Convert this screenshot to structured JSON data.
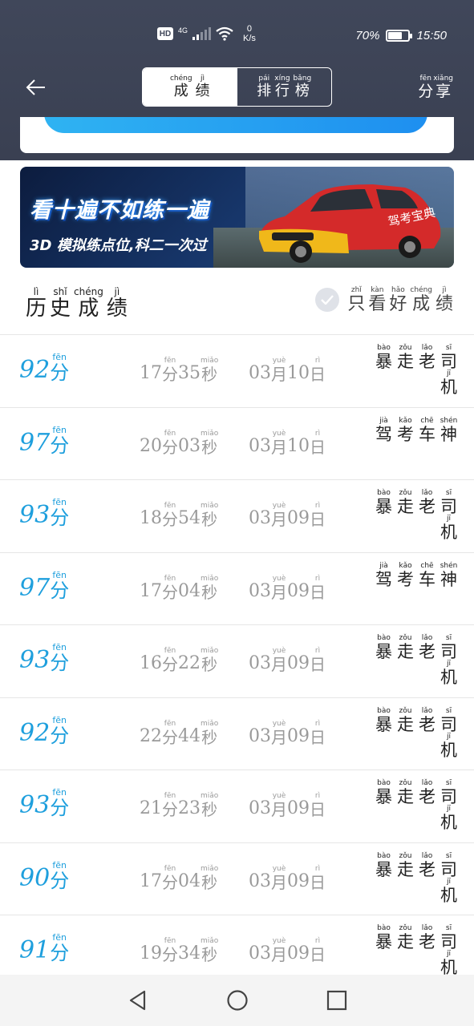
{
  "status_bar": {
    "hd": "HD",
    "network": "4G",
    "speed_value": "0",
    "speed_unit": "K/s",
    "battery": "70%",
    "battery_level": 0.7,
    "time": "15:50"
  },
  "header": {
    "tabs": [
      {
        "label": [
          "成",
          "绩"
        ],
        "pinyin": [
          "chéng",
          "jì"
        ],
        "active": true
      },
      {
        "label": [
          "排",
          "行",
          "榜"
        ],
        "pinyin": [
          "pái",
          "xíng",
          "bǎng"
        ],
        "active": false
      }
    ],
    "share": {
      "label": [
        "分",
        "享"
      ],
      "pinyin": [
        "fēn",
        "xiǎng"
      ]
    }
  },
  "banner": {
    "headline": "看十遍不如练一遍",
    "subline": "3D 模拟练点位,科二一次过",
    "car_text": "驾考宝典"
  },
  "section": {
    "title": {
      "label": [
        "历",
        "史",
        "成",
        "绩"
      ],
      "pinyin": [
        "lì",
        "shǐ",
        "chéng",
        "jì"
      ]
    },
    "filter": {
      "label": [
        "只",
        "看",
        "好",
        "成",
        "绩"
      ],
      "pinyin": [
        "zhǐ",
        "kàn",
        "hǎo",
        "chéng",
        "jì"
      ]
    }
  },
  "units": {
    "fen": {
      "hz": "分",
      "py": "fēn"
    },
    "miao": {
      "hz": "秒",
      "py": "miǎo"
    },
    "yue": {
      "hz": "月",
      "py": "yuè"
    },
    "ri": {
      "hz": "日",
      "py": "rì"
    }
  },
  "titles": {
    "baozou": {
      "label": [
        "暴",
        "走",
        "老",
        "司",
        "机"
      ],
      "pinyin": [
        "bào",
        "zǒu",
        "lǎo",
        "sī",
        "jī"
      ]
    },
    "jiakao": {
      "label": [
        "驾",
        "考",
        "车",
        "神"
      ],
      "pinyin": [
        "jià",
        "kǎo",
        "chē",
        "shén"
      ]
    }
  },
  "records": [
    {
      "score": "92",
      "min": "17",
      "sec": "35",
      "month": "03",
      "day": "10",
      "title": "baozou"
    },
    {
      "score": "97",
      "min": "20",
      "sec": "03",
      "month": "03",
      "day": "10",
      "title": "jiakao"
    },
    {
      "score": "93",
      "min": "18",
      "sec": "54",
      "month": "03",
      "day": "09",
      "title": "baozou"
    },
    {
      "score": "97",
      "min": "17",
      "sec": "04",
      "month": "03",
      "day": "09",
      "title": "jiakao"
    },
    {
      "score": "93",
      "min": "16",
      "sec": "22",
      "month": "03",
      "day": "09",
      "title": "baozou"
    },
    {
      "score": "92",
      "min": "22",
      "sec": "44",
      "month": "03",
      "day": "09",
      "title": "baozou"
    },
    {
      "score": "93",
      "min": "21",
      "sec": "23",
      "month": "03",
      "day": "09",
      "title": "baozou"
    },
    {
      "score": "90",
      "min": "17",
      "sec": "04",
      "month": "03",
      "day": "09",
      "title": "baozou"
    },
    {
      "score": "91",
      "min": "19",
      "sec": "34",
      "month": "03",
      "day": "09",
      "title": "baozou"
    }
  ],
  "colors": {
    "accent": "#1e9fdd",
    "header_bg": "#40475a",
    "muted": "#9a9a9a"
  }
}
